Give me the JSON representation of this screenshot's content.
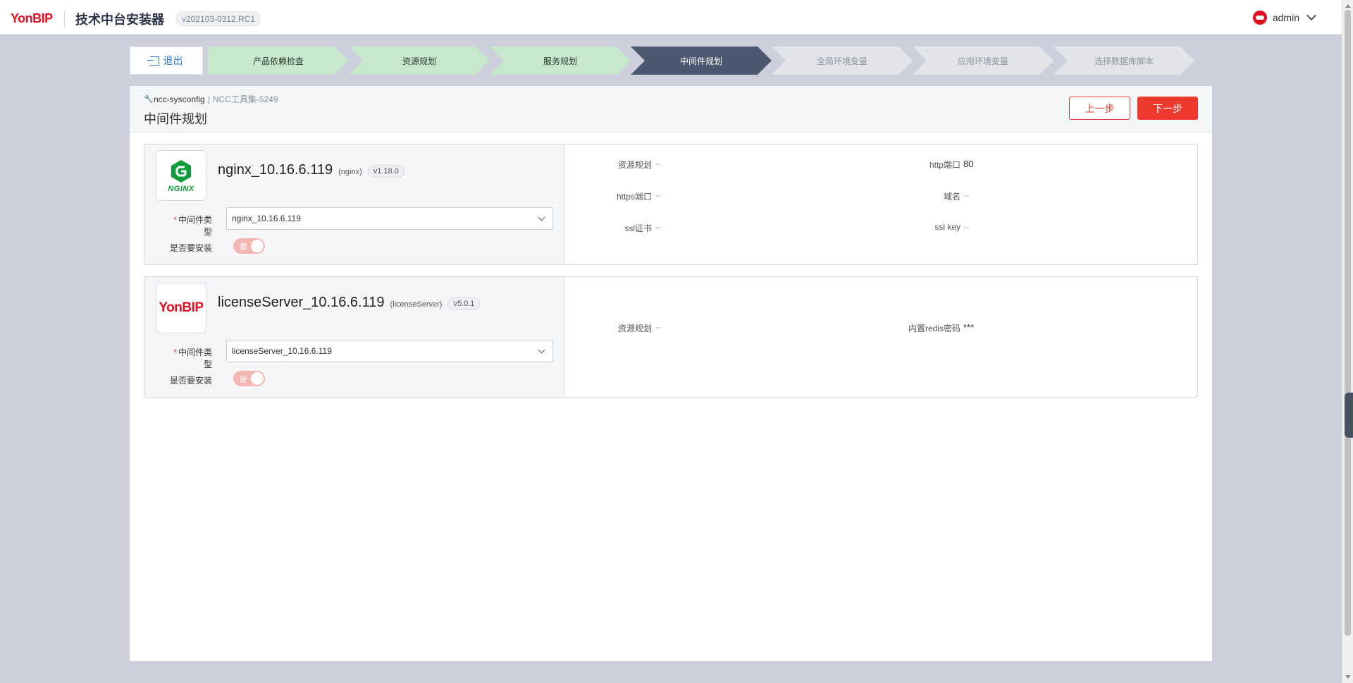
{
  "header": {
    "logo_yon": "Yon",
    "logo_bip": "BIP",
    "app_title": "技术中台安装器",
    "version": "v202103-0312.RC1",
    "user_name": "admin"
  },
  "nav": {
    "exit_label": "退出",
    "steps": [
      {
        "label": "产品依赖检查",
        "state": "done"
      },
      {
        "label": "资源规划",
        "state": "done"
      },
      {
        "label": "服务规划",
        "state": "done"
      },
      {
        "label": "中间件规划",
        "state": "active"
      },
      {
        "label": "全局环境变量",
        "state": "todo"
      },
      {
        "label": "应用环境变量",
        "state": "todo"
      },
      {
        "label": "选择数据库脚本",
        "state": "todo"
      }
    ]
  },
  "page": {
    "crumb_app": "ncc-sysconfig",
    "crumb_sep": "|",
    "crumb_tool": "NCC工具集-5249",
    "title": "中间件规划",
    "prev_label": "上一步",
    "next_label": "下一步"
  },
  "middlewares": [
    {
      "logo_text": "NGINX",
      "name": "nginx_10.16.6.119",
      "type": "(nginx)",
      "version": "v1.18.0",
      "type_label": "中间件类型",
      "type_value": "nginx_10.16.6.119",
      "install_label": "是否要安装",
      "install_state": "是",
      "props": [
        {
          "label": "资源规划",
          "value": "--"
        },
        {
          "label": "http端口",
          "value": "80"
        },
        {
          "label": "https端口",
          "value": "--"
        },
        {
          "label": "域名",
          "value": "--"
        },
        {
          "label": "ssl证书",
          "value": "--"
        },
        {
          "label": "ssl key",
          "value": "--"
        }
      ]
    },
    {
      "logo_text": "YonBIP",
      "name": "licenseServer_10.16.6.119",
      "type": "(licenseServer)",
      "version": "v5.0.1",
      "type_label": "中间件类型",
      "type_value": "licenseServer_10.16.6.119",
      "install_label": "是否要安装",
      "install_state": "是",
      "props": [
        {
          "label": "资源规划",
          "value": "--"
        },
        {
          "label": "内置redis密码",
          "value": "***"
        }
      ]
    }
  ],
  "colors": {
    "brand_red": "#e30f22",
    "accent_blue": "#2d7bd6",
    "step_done": "#c7e8cc",
    "step_active": "#4c5870",
    "step_todo": "#e2e4ea",
    "primary_button": "#ee3a2c"
  }
}
